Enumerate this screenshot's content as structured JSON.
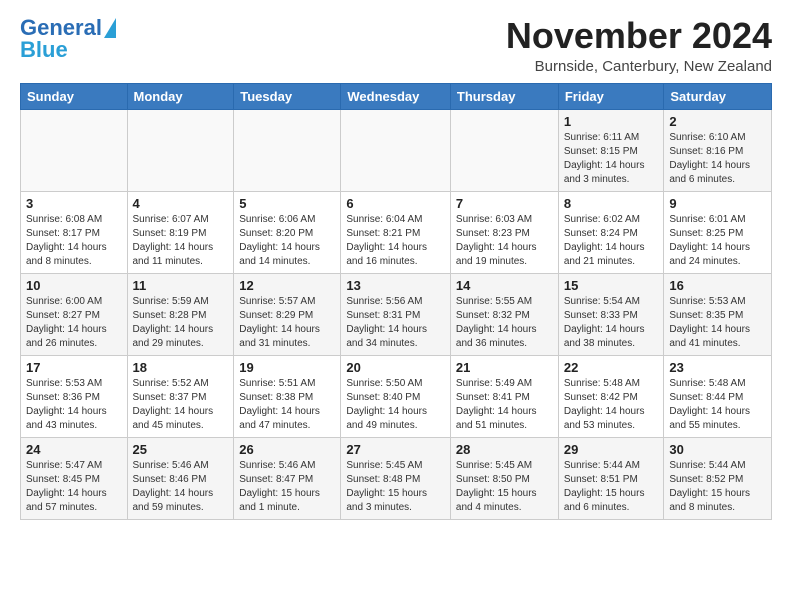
{
  "logo": {
    "line1": "General",
    "line2": "Blue"
  },
  "header": {
    "month": "November 2024",
    "location": "Burnside, Canterbury, New Zealand"
  },
  "weekdays": [
    "Sunday",
    "Monday",
    "Tuesday",
    "Wednesday",
    "Thursday",
    "Friday",
    "Saturday"
  ],
  "weeks": [
    [
      {
        "day": "",
        "info": ""
      },
      {
        "day": "",
        "info": ""
      },
      {
        "day": "",
        "info": ""
      },
      {
        "day": "",
        "info": ""
      },
      {
        "day": "",
        "info": ""
      },
      {
        "day": "1",
        "info": "Sunrise: 6:11 AM\nSunset: 8:15 PM\nDaylight: 14 hours\nand 3 minutes."
      },
      {
        "day": "2",
        "info": "Sunrise: 6:10 AM\nSunset: 8:16 PM\nDaylight: 14 hours\nand 6 minutes."
      }
    ],
    [
      {
        "day": "3",
        "info": "Sunrise: 6:08 AM\nSunset: 8:17 PM\nDaylight: 14 hours\nand 8 minutes."
      },
      {
        "day": "4",
        "info": "Sunrise: 6:07 AM\nSunset: 8:19 PM\nDaylight: 14 hours\nand 11 minutes."
      },
      {
        "day": "5",
        "info": "Sunrise: 6:06 AM\nSunset: 8:20 PM\nDaylight: 14 hours\nand 14 minutes."
      },
      {
        "day": "6",
        "info": "Sunrise: 6:04 AM\nSunset: 8:21 PM\nDaylight: 14 hours\nand 16 minutes."
      },
      {
        "day": "7",
        "info": "Sunrise: 6:03 AM\nSunset: 8:23 PM\nDaylight: 14 hours\nand 19 minutes."
      },
      {
        "day": "8",
        "info": "Sunrise: 6:02 AM\nSunset: 8:24 PM\nDaylight: 14 hours\nand 21 minutes."
      },
      {
        "day": "9",
        "info": "Sunrise: 6:01 AM\nSunset: 8:25 PM\nDaylight: 14 hours\nand 24 minutes."
      }
    ],
    [
      {
        "day": "10",
        "info": "Sunrise: 6:00 AM\nSunset: 8:27 PM\nDaylight: 14 hours\nand 26 minutes."
      },
      {
        "day": "11",
        "info": "Sunrise: 5:59 AM\nSunset: 8:28 PM\nDaylight: 14 hours\nand 29 minutes."
      },
      {
        "day": "12",
        "info": "Sunrise: 5:57 AM\nSunset: 8:29 PM\nDaylight: 14 hours\nand 31 minutes."
      },
      {
        "day": "13",
        "info": "Sunrise: 5:56 AM\nSunset: 8:31 PM\nDaylight: 14 hours\nand 34 minutes."
      },
      {
        "day": "14",
        "info": "Sunrise: 5:55 AM\nSunset: 8:32 PM\nDaylight: 14 hours\nand 36 minutes."
      },
      {
        "day": "15",
        "info": "Sunrise: 5:54 AM\nSunset: 8:33 PM\nDaylight: 14 hours\nand 38 minutes."
      },
      {
        "day": "16",
        "info": "Sunrise: 5:53 AM\nSunset: 8:35 PM\nDaylight: 14 hours\nand 41 minutes."
      }
    ],
    [
      {
        "day": "17",
        "info": "Sunrise: 5:53 AM\nSunset: 8:36 PM\nDaylight: 14 hours\nand 43 minutes."
      },
      {
        "day": "18",
        "info": "Sunrise: 5:52 AM\nSunset: 8:37 PM\nDaylight: 14 hours\nand 45 minutes."
      },
      {
        "day": "19",
        "info": "Sunrise: 5:51 AM\nSunset: 8:38 PM\nDaylight: 14 hours\nand 47 minutes."
      },
      {
        "day": "20",
        "info": "Sunrise: 5:50 AM\nSunset: 8:40 PM\nDaylight: 14 hours\nand 49 minutes."
      },
      {
        "day": "21",
        "info": "Sunrise: 5:49 AM\nSunset: 8:41 PM\nDaylight: 14 hours\nand 51 minutes."
      },
      {
        "day": "22",
        "info": "Sunrise: 5:48 AM\nSunset: 8:42 PM\nDaylight: 14 hours\nand 53 minutes."
      },
      {
        "day": "23",
        "info": "Sunrise: 5:48 AM\nSunset: 8:44 PM\nDaylight: 14 hours\nand 55 minutes."
      }
    ],
    [
      {
        "day": "24",
        "info": "Sunrise: 5:47 AM\nSunset: 8:45 PM\nDaylight: 14 hours\nand 57 minutes."
      },
      {
        "day": "25",
        "info": "Sunrise: 5:46 AM\nSunset: 8:46 PM\nDaylight: 14 hours\nand 59 minutes."
      },
      {
        "day": "26",
        "info": "Sunrise: 5:46 AM\nSunset: 8:47 PM\nDaylight: 15 hours\nand 1 minute."
      },
      {
        "day": "27",
        "info": "Sunrise: 5:45 AM\nSunset: 8:48 PM\nDaylight: 15 hours\nand 3 minutes."
      },
      {
        "day": "28",
        "info": "Sunrise: 5:45 AM\nSunset: 8:50 PM\nDaylight: 15 hours\nand 4 minutes."
      },
      {
        "day": "29",
        "info": "Sunrise: 5:44 AM\nSunset: 8:51 PM\nDaylight: 15 hours\nand 6 minutes."
      },
      {
        "day": "30",
        "info": "Sunrise: 5:44 AM\nSunset: 8:52 PM\nDaylight: 15 hours\nand 8 minutes."
      }
    ]
  ]
}
